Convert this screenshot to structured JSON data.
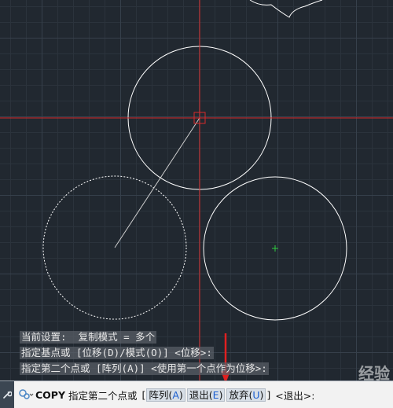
{
  "history": {
    "line1": "当前设置:  复制模式 = 多个",
    "line2": "指定基点或 [位移(D)/模式(O)] <位移>:",
    "line3": "指定第二个点或 [阵列(A)] <使用第一个点作为位移>:"
  },
  "command": {
    "name": "COPY",
    "prompt": "指定第二个点或",
    "bracket_open": "[",
    "options": [
      {
        "label": "阵列(",
        "key": "A",
        "close": ")"
      },
      {
        "label": "退出(",
        "key": "E",
        "close": ")"
      },
      {
        "label": "放弃(",
        "key": "U",
        "close": ")"
      }
    ],
    "bracket_close": "]",
    "default": "<退出>:"
  },
  "watermark": "经验",
  "icons": {
    "tool": "wrench-icon",
    "recent": "command-recent-icon"
  },
  "colors": {
    "background": "#212830",
    "crosshair": "#d62a2a",
    "entity": "#ffffff",
    "center_marker": "#2ecc40",
    "annotation_arrow": "#e02020"
  }
}
